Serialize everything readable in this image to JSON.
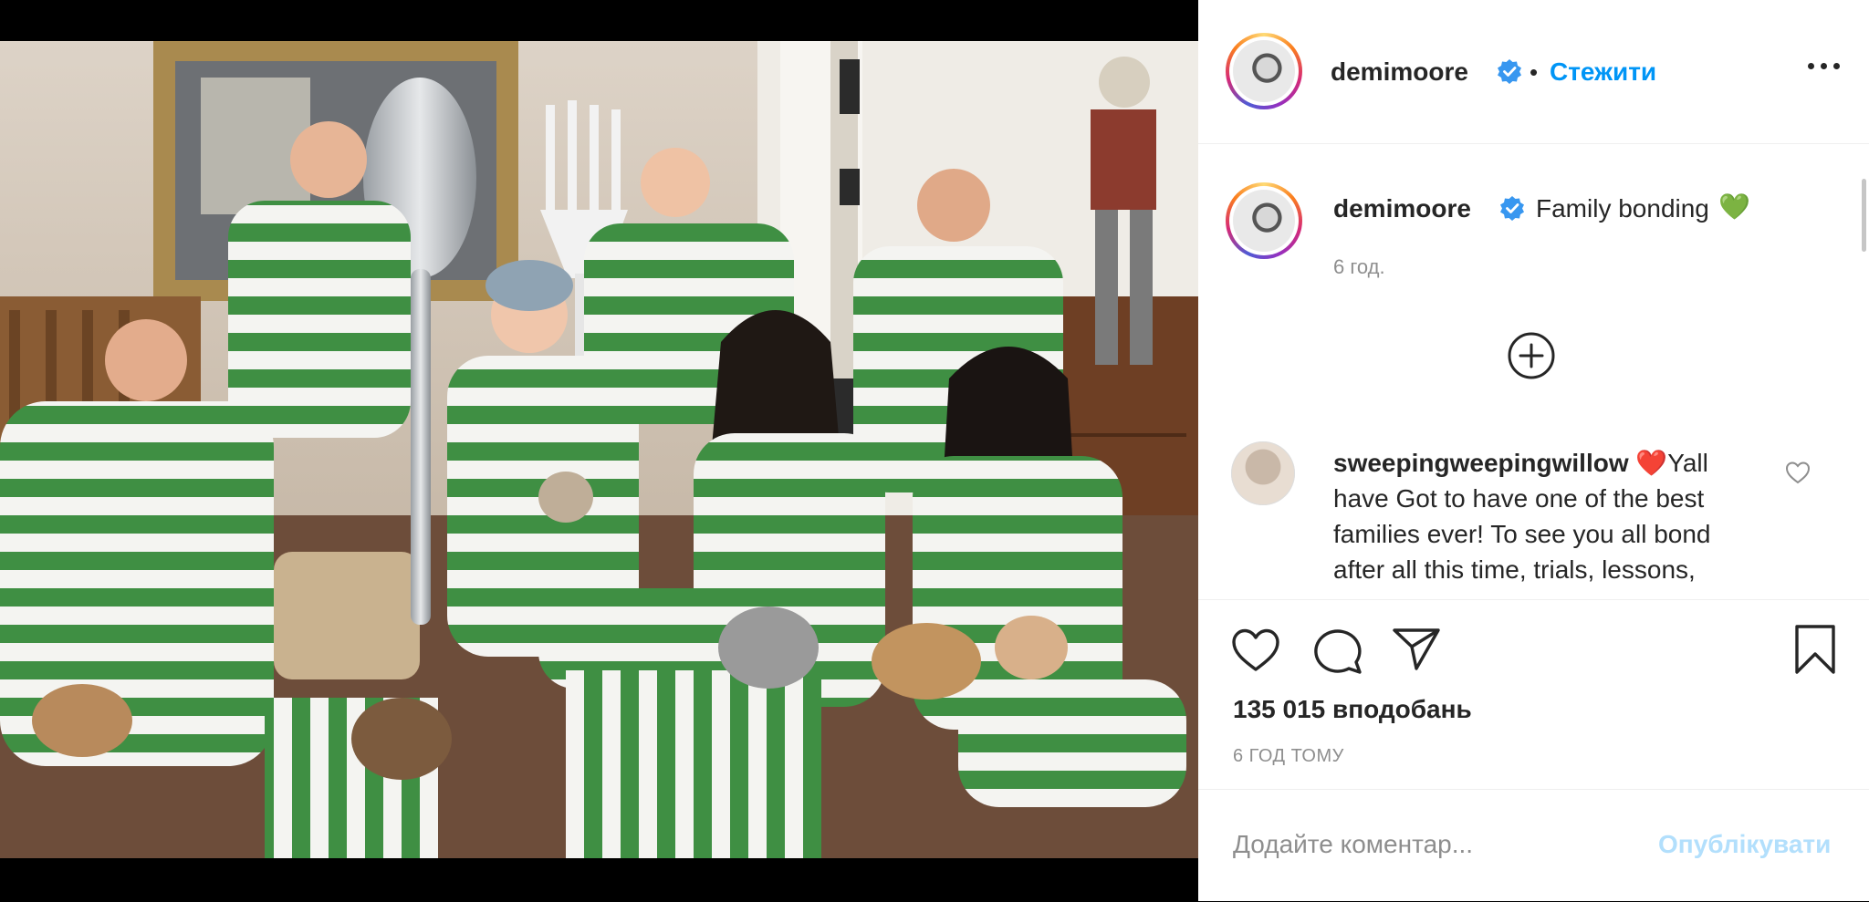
{
  "post": {
    "username": "demimoore",
    "follow_separator": "•",
    "follow_label": "Стежити",
    "caption_text": "Family bonding",
    "caption_emoji": "💚",
    "caption_time": "6 год.",
    "likes": "135 015 вподобань",
    "posted_ago": "6 ГОД ТОМУ"
  },
  "comments": [
    {
      "username": "sweepingweepingwillow",
      "emoji": "❤️",
      "text": "Yall have Got to have one of the best families ever! To see you all bond after all this time, trials, lessons,"
    }
  ],
  "comment_box": {
    "placeholder": "Додайте коментар...",
    "publish_label": "Опублікувати"
  },
  "colors": {
    "link": "#0095f6",
    "publish_disabled": "#b2dffc",
    "verified": "#3897f0",
    "stripe_green": "#3f8f43"
  },
  "icons": {
    "verified": "verified-badge-icon",
    "more": "more-options-icon",
    "load_more": "load-more-comments-icon",
    "like": "heart-icon",
    "comment": "comment-bubble-icon",
    "share": "paper-plane-icon",
    "save": "bookmark-icon",
    "comment_like": "small-heart-icon"
  }
}
